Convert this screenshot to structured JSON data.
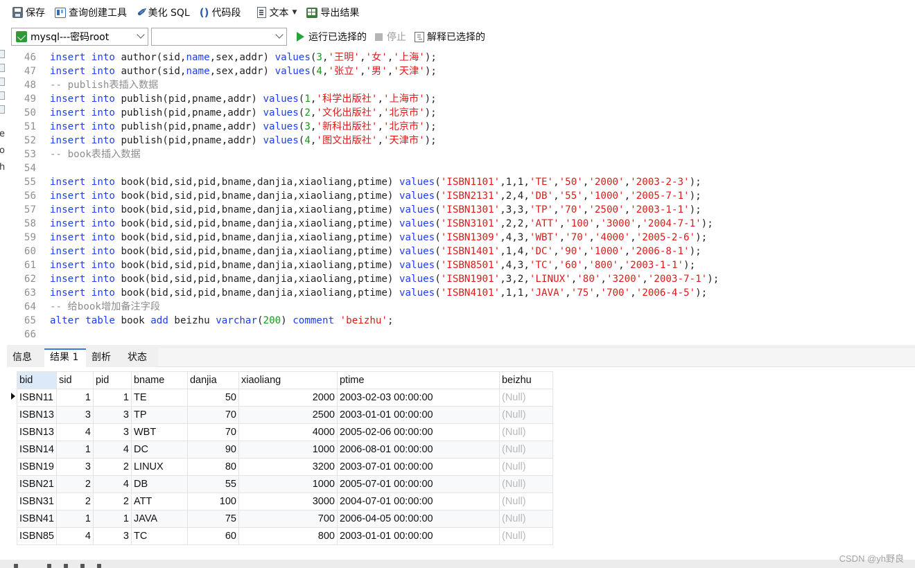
{
  "toolbar": {
    "save": "保存",
    "query_builder": "查询创建工具",
    "beautify": "美化 SQL",
    "snippet": "代码段",
    "text": "文本",
    "export": "导出结果"
  },
  "connbar": {
    "connection": "mysql---密码root",
    "database": "",
    "run_selected": "运行已选择的",
    "stop": "停止",
    "explain_selected": "解释已选择的"
  },
  "editor": {
    "lines": [
      {
        "n": "46",
        "t": [
          [
            "kw",
            "insert"
          ],
          [
            "plain",
            " "
          ],
          [
            "kw",
            "into"
          ],
          [
            "plain",
            " author(sid,"
          ],
          [
            "fn",
            "name"
          ],
          [
            "plain",
            ",sex,addr) "
          ],
          [
            "fn",
            "values"
          ],
          [
            "plain",
            "("
          ],
          [
            "num",
            "3"
          ],
          [
            "plain",
            ","
          ],
          [
            "str",
            "'王明'"
          ],
          [
            "plain",
            ","
          ],
          [
            "str",
            "'女'"
          ],
          [
            "plain",
            ","
          ],
          [
            "str",
            "'上海'"
          ],
          [
            "plain",
            ");"
          ]
        ]
      },
      {
        "n": "47",
        "t": [
          [
            "kw",
            "insert"
          ],
          [
            "plain",
            " "
          ],
          [
            "kw",
            "into"
          ],
          [
            "plain",
            " author(sid,"
          ],
          [
            "fn",
            "name"
          ],
          [
            "plain",
            ",sex,addr) "
          ],
          [
            "fn",
            "values"
          ],
          [
            "plain",
            "("
          ],
          [
            "num",
            "4"
          ],
          [
            "plain",
            ","
          ],
          [
            "str",
            "'张立'"
          ],
          [
            "plain",
            ","
          ],
          [
            "str",
            "'男'"
          ],
          [
            "plain",
            ","
          ],
          [
            "str",
            "'天津'"
          ],
          [
            "plain",
            ");"
          ]
        ]
      },
      {
        "n": "48",
        "t": [
          [
            "cmt",
            "-- publish表插入数据"
          ]
        ]
      },
      {
        "n": "49",
        "t": [
          [
            "kw",
            "insert"
          ],
          [
            "plain",
            " "
          ],
          [
            "kw",
            "into"
          ],
          [
            "plain",
            " publish(pid,pname,addr) "
          ],
          [
            "fn",
            "values"
          ],
          [
            "plain",
            "("
          ],
          [
            "num",
            "1"
          ],
          [
            "plain",
            ","
          ],
          [
            "str",
            "'科学出版社'"
          ],
          [
            "plain",
            ","
          ],
          [
            "str",
            "'上海市'"
          ],
          [
            "plain",
            ");"
          ]
        ]
      },
      {
        "n": "50",
        "t": [
          [
            "kw",
            "insert"
          ],
          [
            "plain",
            " "
          ],
          [
            "kw",
            "into"
          ],
          [
            "plain",
            " publish(pid,pname,addr) "
          ],
          [
            "fn",
            "values"
          ],
          [
            "plain",
            "("
          ],
          [
            "num",
            "2"
          ],
          [
            "plain",
            ","
          ],
          [
            "str",
            "'文化出版社'"
          ],
          [
            "plain",
            ","
          ],
          [
            "str",
            "'北京市'"
          ],
          [
            "plain",
            ");"
          ]
        ]
      },
      {
        "n": "51",
        "t": [
          [
            "kw",
            "insert"
          ],
          [
            "plain",
            " "
          ],
          [
            "kw",
            "into"
          ],
          [
            "plain",
            " publish(pid,pname,addr) "
          ],
          [
            "fn",
            "values"
          ],
          [
            "plain",
            "("
          ],
          [
            "num",
            "3"
          ],
          [
            "plain",
            ","
          ],
          [
            "str",
            "'新科出版社'"
          ],
          [
            "plain",
            ","
          ],
          [
            "str",
            "'北京市'"
          ],
          [
            "plain",
            ");"
          ]
        ]
      },
      {
        "n": "52",
        "t": [
          [
            "kw",
            "insert"
          ],
          [
            "plain",
            " "
          ],
          [
            "kw",
            "into"
          ],
          [
            "plain",
            " publish(pid,pname,addr) "
          ],
          [
            "fn",
            "values"
          ],
          [
            "plain",
            "("
          ],
          [
            "num",
            "4"
          ],
          [
            "plain",
            ","
          ],
          [
            "str",
            "'图文出版社'"
          ],
          [
            "plain",
            ","
          ],
          [
            "str",
            "'天津市'"
          ],
          [
            "plain",
            ");"
          ]
        ]
      },
      {
        "n": "53",
        "t": [
          [
            "cmt",
            "-- book表插入数据"
          ]
        ]
      },
      {
        "n": "54",
        "t": []
      },
      {
        "n": "55",
        "t": [
          [
            "kw",
            "insert"
          ],
          [
            "plain",
            " "
          ],
          [
            "kw",
            "into"
          ],
          [
            "plain",
            " book(bid,sid,pid,bname,danjia,xiaoliang,ptime) "
          ],
          [
            "fn",
            "values"
          ],
          [
            "plain",
            "("
          ],
          [
            "str",
            "'ISBN1101'"
          ],
          [
            "plain",
            ",1,1,"
          ],
          [
            "str",
            "'TE'"
          ],
          [
            "plain",
            ","
          ],
          [
            "str",
            "'50'"
          ],
          [
            "plain",
            ","
          ],
          [
            "str",
            "'2000'"
          ],
          [
            "plain",
            ","
          ],
          [
            "str",
            "'2003-2-3'"
          ],
          [
            "plain",
            ");"
          ]
        ]
      },
      {
        "n": "56",
        "t": [
          [
            "kw",
            "insert"
          ],
          [
            "plain",
            " "
          ],
          [
            "kw",
            "into"
          ],
          [
            "plain",
            " book(bid,sid,pid,bname,danjia,xiaoliang,ptime) "
          ],
          [
            "fn",
            "values"
          ],
          [
            "plain",
            "("
          ],
          [
            "str",
            "'ISBN2131'"
          ],
          [
            "plain",
            ",2,4,"
          ],
          [
            "str",
            "'DB'"
          ],
          [
            "plain",
            ","
          ],
          [
            "str",
            "'55'"
          ],
          [
            "plain",
            ","
          ],
          [
            "str",
            "'1000'"
          ],
          [
            "plain",
            ","
          ],
          [
            "str",
            "'2005-7-1'"
          ],
          [
            "plain",
            ");"
          ]
        ]
      },
      {
        "n": "57",
        "t": [
          [
            "kw",
            "insert"
          ],
          [
            "plain",
            " "
          ],
          [
            "kw",
            "into"
          ],
          [
            "plain",
            " book(bid,sid,pid,bname,danjia,xiaoliang,ptime) "
          ],
          [
            "fn",
            "values"
          ],
          [
            "plain",
            "("
          ],
          [
            "str",
            "'ISBN1301'"
          ],
          [
            "plain",
            ",3,3,"
          ],
          [
            "str",
            "'TP'"
          ],
          [
            "plain",
            ","
          ],
          [
            "str",
            "'70'"
          ],
          [
            "plain",
            ","
          ],
          [
            "str",
            "'2500'"
          ],
          [
            "plain",
            ","
          ],
          [
            "str",
            "'2003-1-1'"
          ],
          [
            "plain",
            ");"
          ]
        ]
      },
      {
        "n": "58",
        "t": [
          [
            "kw",
            "insert"
          ],
          [
            "plain",
            " "
          ],
          [
            "kw",
            "into"
          ],
          [
            "plain",
            " book(bid,sid,pid,bname,danjia,xiaoliang,ptime) "
          ],
          [
            "fn",
            "values"
          ],
          [
            "plain",
            "("
          ],
          [
            "str",
            "'ISBN3101'"
          ],
          [
            "plain",
            ",2,2,"
          ],
          [
            "str",
            "'ATT'"
          ],
          [
            "plain",
            ","
          ],
          [
            "str",
            "'100'"
          ],
          [
            "plain",
            ","
          ],
          [
            "str",
            "'3000'"
          ],
          [
            "plain",
            ","
          ],
          [
            "str",
            "'2004-7-1'"
          ],
          [
            "plain",
            ");"
          ]
        ]
      },
      {
        "n": "59",
        "t": [
          [
            "kw",
            "insert"
          ],
          [
            "plain",
            " "
          ],
          [
            "kw",
            "into"
          ],
          [
            "plain",
            " book(bid,sid,pid,bname,danjia,xiaoliang,ptime) "
          ],
          [
            "fn",
            "values"
          ],
          [
            "plain",
            "("
          ],
          [
            "str",
            "'ISBN1309'"
          ],
          [
            "plain",
            ",4,3,"
          ],
          [
            "str",
            "'WBT'"
          ],
          [
            "plain",
            ","
          ],
          [
            "str",
            "'70'"
          ],
          [
            "plain",
            ","
          ],
          [
            "str",
            "'4000'"
          ],
          [
            "plain",
            ","
          ],
          [
            "str",
            "'2005-2-6'"
          ],
          [
            "plain",
            ");"
          ]
        ]
      },
      {
        "n": "60",
        "t": [
          [
            "kw",
            "insert"
          ],
          [
            "plain",
            " "
          ],
          [
            "kw",
            "into"
          ],
          [
            "plain",
            " book(bid,sid,pid,bname,danjia,xiaoliang,ptime) "
          ],
          [
            "fn",
            "values"
          ],
          [
            "plain",
            "("
          ],
          [
            "str",
            "'ISBN1401'"
          ],
          [
            "plain",
            ",1,4,"
          ],
          [
            "str",
            "'DC'"
          ],
          [
            "plain",
            ","
          ],
          [
            "str",
            "'90'"
          ],
          [
            "plain",
            ","
          ],
          [
            "str",
            "'1000'"
          ],
          [
            "plain",
            ","
          ],
          [
            "str",
            "'2006-8-1'"
          ],
          [
            "plain",
            ");"
          ]
        ]
      },
      {
        "n": "61",
        "t": [
          [
            "kw",
            "insert"
          ],
          [
            "plain",
            " "
          ],
          [
            "kw",
            "into"
          ],
          [
            "plain",
            " book(bid,sid,pid,bname,danjia,xiaoliang,ptime) "
          ],
          [
            "fn",
            "values"
          ],
          [
            "plain",
            "("
          ],
          [
            "str",
            "'ISBN8501'"
          ],
          [
            "plain",
            ",4,3,"
          ],
          [
            "str",
            "'TC'"
          ],
          [
            "plain",
            ","
          ],
          [
            "str",
            "'60'"
          ],
          [
            "plain",
            ","
          ],
          [
            "str",
            "'800'"
          ],
          [
            "plain",
            ","
          ],
          [
            "str",
            "'2003-1-1'"
          ],
          [
            "plain",
            ");"
          ]
        ]
      },
      {
        "n": "62",
        "t": [
          [
            "kw",
            "insert"
          ],
          [
            "plain",
            " "
          ],
          [
            "kw",
            "into"
          ],
          [
            "plain",
            " book(bid,sid,pid,bname,danjia,xiaoliang,ptime) "
          ],
          [
            "fn",
            "values"
          ],
          [
            "plain",
            "("
          ],
          [
            "str",
            "'ISBN1901'"
          ],
          [
            "plain",
            ",3,2,"
          ],
          [
            "str",
            "'LINUX'"
          ],
          [
            "plain",
            ","
          ],
          [
            "str",
            "'80'"
          ],
          [
            "plain",
            ","
          ],
          [
            "str",
            "'3200'"
          ],
          [
            "plain",
            ","
          ],
          [
            "str",
            "'2003-7-1'"
          ],
          [
            "plain",
            ");"
          ]
        ]
      },
      {
        "n": "63",
        "t": [
          [
            "kw",
            "insert"
          ],
          [
            "plain",
            " "
          ],
          [
            "kw",
            "into"
          ],
          [
            "plain",
            " book(bid,sid,pid,bname,danjia,xiaoliang,ptime) "
          ],
          [
            "fn",
            "values"
          ],
          [
            "plain",
            "("
          ],
          [
            "str",
            "'ISBN4101'"
          ],
          [
            "plain",
            ",1,1,"
          ],
          [
            "str",
            "'JAVA'"
          ],
          [
            "plain",
            ","
          ],
          [
            "str",
            "'75'"
          ],
          [
            "plain",
            ","
          ],
          [
            "str",
            "'700'"
          ],
          [
            "plain",
            ","
          ],
          [
            "str",
            "'2006-4-5'"
          ],
          [
            "plain",
            ");"
          ]
        ]
      },
      {
        "n": "64",
        "t": [
          [
            "cmt",
            "-- 给book增加备注字段"
          ]
        ]
      },
      {
        "n": "65",
        "t": [
          [
            "kw",
            "alter"
          ],
          [
            "plain",
            " "
          ],
          [
            "kw",
            "table"
          ],
          [
            "plain",
            " book "
          ],
          [
            "kw",
            "add"
          ],
          [
            "plain",
            " beizhu "
          ],
          [
            "kw",
            "varchar"
          ],
          [
            "plain",
            "("
          ],
          [
            "num",
            "200"
          ],
          [
            "plain",
            ") "
          ],
          [
            "kw",
            "comment"
          ],
          [
            "plain",
            " "
          ],
          [
            "str",
            "'beizhu'"
          ],
          [
            "plain",
            ";"
          ]
        ]
      },
      {
        "n": "66",
        "t": []
      }
    ]
  },
  "tabs": [
    "信息",
    "结果 1",
    "剖析",
    "状态"
  ],
  "active_tab": 1,
  "grid": {
    "columns": [
      "bid",
      "sid",
      "pid",
      "bname",
      "danjia",
      "xiaoliang",
      "ptime",
      "beizhu"
    ],
    "rows": [
      [
        "ISBN11",
        "1",
        "1",
        "TE",
        "50",
        "2000",
        "2003-02-03 00:00:00",
        "(Null)"
      ],
      [
        "ISBN13",
        "3",
        "3",
        "TP",
        "70",
        "2500",
        "2003-01-01 00:00:00",
        "(Null)"
      ],
      [
        "ISBN13",
        "4",
        "3",
        "WBT",
        "70",
        "4000",
        "2005-02-06 00:00:00",
        "(Null)"
      ],
      [
        "ISBN14",
        "1",
        "4",
        "DC",
        "90",
        "1000",
        "2006-08-01 00:00:00",
        "(Null)"
      ],
      [
        "ISBN19",
        "3",
        "2",
        "LINUX",
        "80",
        "3200",
        "2003-07-01 00:00:00",
        "(Null)"
      ],
      [
        "ISBN21",
        "2",
        "4",
        "DB",
        "55",
        "1000",
        "2005-07-01 00:00:00",
        "(Null)"
      ],
      [
        "ISBN31",
        "2",
        "2",
        "ATT",
        "100",
        "3000",
        "2004-07-01 00:00:00",
        "(Null)"
      ],
      [
        "ISBN41",
        "1",
        "1",
        "JAVA",
        "75",
        "700",
        "2006-04-05 00:00:00",
        "(Null)"
      ],
      [
        "ISBN85",
        "4",
        "3",
        "TC",
        "60",
        "800",
        "2003-01-01 00:00:00",
        "(Null)"
      ]
    ]
  },
  "left_strip_letters": [
    "e",
    "o",
    "h"
  ],
  "watermark": "CSDN @yh野良"
}
